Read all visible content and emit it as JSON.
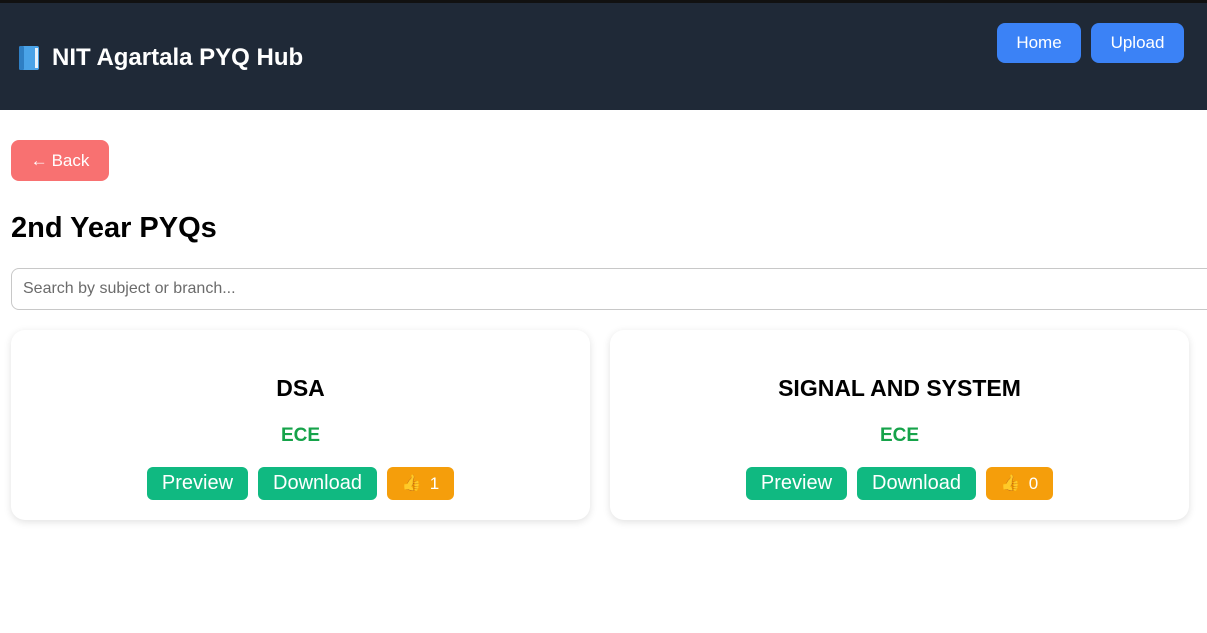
{
  "header": {
    "brand_icon": "book-icon",
    "title": "NIT Agartala PYQ Hub",
    "nav": {
      "home_label": "Home",
      "upload_label": "Upload"
    },
    "colors": {
      "background": "#1f2937",
      "nav_button": "#3b82f6"
    }
  },
  "back": {
    "arrow": "←",
    "label": "Back",
    "color": "#f87171"
  },
  "page": {
    "title": "2nd Year PYQs"
  },
  "search": {
    "placeholder": "Search by subject or branch...",
    "value": ""
  },
  "cards": [
    {
      "subject": "DSA",
      "branch": "ECE",
      "preview_label": "Preview",
      "download_label": "Download",
      "like_icon": "thumbs-up-icon",
      "likes": "1"
    },
    {
      "subject": "SIGNAL AND SYSTEM",
      "branch": "ECE",
      "preview_label": "Preview",
      "download_label": "Download",
      "like_icon": "thumbs-up-icon",
      "likes": "0"
    }
  ],
  "colors": {
    "branch_text": "#16a34a",
    "action_button": "#10b981",
    "like_button": "#f59e0b"
  }
}
